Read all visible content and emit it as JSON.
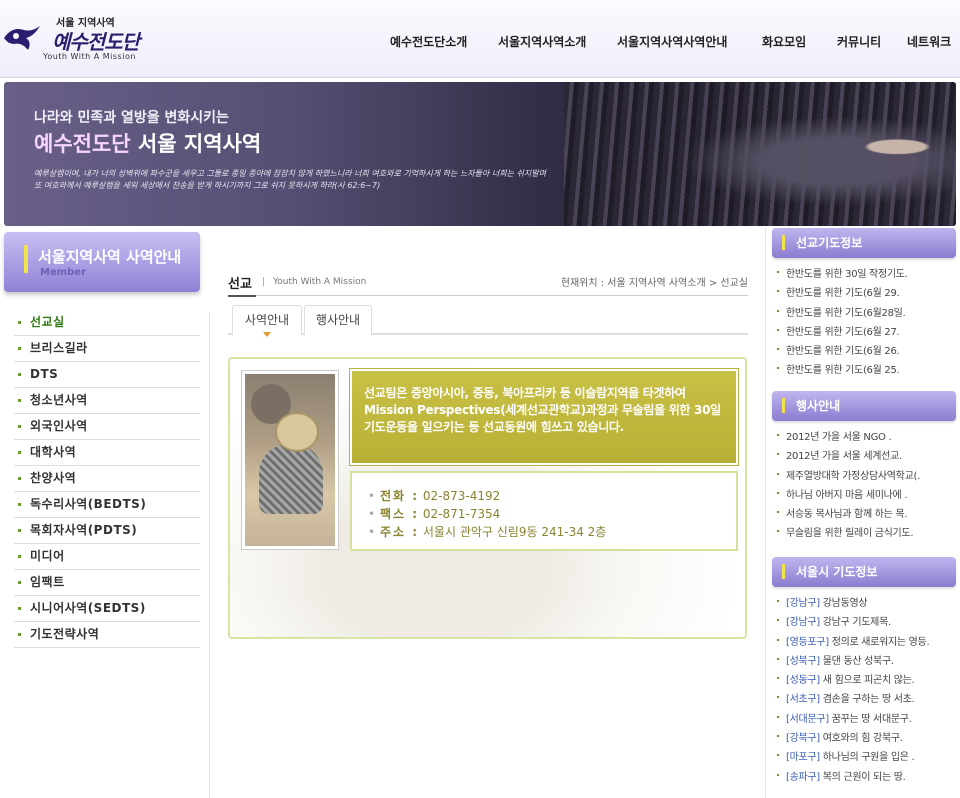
{
  "header": {
    "logo_top": "서울 지역사역",
    "logo_main": "예수전도단",
    "logo_sub": "Youth With A Mission",
    "nav": [
      "예수전도단소개",
      "서울지역사역소개",
      "서울지역사역사역안내",
      "화요모임",
      "커뮤니티",
      "네트워크"
    ]
  },
  "banner": {
    "line1": "나라와 민족과 열방을 변화시키는",
    "line2_a": "예수전도단",
    "line2_b": " 서울 지역사역",
    "desc": "예루살렘이여, 내가 너의 성벽위에 파수군을 세우고 그들로 종일 종야에 잠잠치 않게 하였느니라 너희 여호와로 기억하시게 하는 느자들아 너희는 쉬지말며 또 여호와께서 예루살렘을 세워 세상에서 찬송을 받게 하시기까지 그로 쉬지 못하시게 하라(사 62:6~7)"
  },
  "sidebar": {
    "title": "서울지역사역 사역안내",
    "subtitle": "Member",
    "items": [
      "선교실",
      "브리스길라",
      "DTS",
      "청소년사역",
      "외국인사역",
      "대학사역",
      "찬양사역",
      "독수리사역(BEDTS)",
      "목회자사역(PDTS)",
      "미디어",
      "임팩트",
      "시니어사역(SEDTS)",
      "기도전략사역"
    ]
  },
  "content": {
    "section": "선교",
    "sep": "|",
    "sub": "Youth With A Mission",
    "location": "현재위치 : 서울 지역사역 사역소개 > 선교실",
    "tabs": [
      "사역안내",
      "행사안내"
    ],
    "intro": "선교팀은 중앙아시아, 중동, 북아프리카 등 이슬람지역을 타겟하여 Mission Perspectives(세계선교관학교)과정과 무슬림을 위한 30일 기도운동을 일으키는 등 선교동원에 힘쓰고 있습니다.",
    "phone_label": "전화 :",
    "phone": "02-873-4192",
    "fax_label": "팩스 :",
    "fax": "02-871-7354",
    "addr_label": "주소 :",
    "addr": "서울시 관악구 신림9동 241-34 2층"
  },
  "right": {
    "prayer_title": "선교기도정보",
    "prayer_items": [
      "한반도를 위한 30일 작정기도.",
      "한반도를 위한 기도(6월 29.",
      "한반도를 위한 기도(6월28일.",
      "한반도를 위한 기도(6월 27.",
      "한반도를 위한 기도(6월 26.",
      "한반도를 위한 기도(6월 25."
    ],
    "event_title": "행사안내",
    "event_items": [
      "2012년 가을 서울 NGO .",
      "2012년 가을 서울 세계선교.",
      "제주열방대학 가정상담사역학교(.",
      "하나님 아버지 마음 세미나에 .",
      "서승동 목사님과 함께 하는 목.",
      "무슬림을 위한 릴레이 금식기도."
    ],
    "seoul_title": "서울시 기도정보",
    "seoul_items": [
      {
        "tag": "[강남구]",
        "text": " 강남동영상"
      },
      {
        "tag": "[강남구]",
        "text": " 강남구 기도제목."
      },
      {
        "tag": "[영등포구]",
        "text": " 정의로 새로워지는 영등."
      },
      {
        "tag": "[성북구]",
        "text": " 물댄 동산 성북구."
      },
      {
        "tag": "[성동구]",
        "text": " 새 힘으로 피곤치 않는."
      },
      {
        "tag": "[서초구]",
        "text": " 겸손을 구하는 땅 서초."
      },
      {
        "tag": "[서대문구]",
        "text": " 꿈꾸는 땅 서대문구."
      },
      {
        "tag": "[강북구]",
        "text": " 여호와의 힘 강북구."
      },
      {
        "tag": "[마포구]",
        "text": " 하나님의 구원을 입은 ."
      },
      {
        "tag": "[송파구]",
        "text": " 복의 근원이 되는 땅."
      }
    ]
  }
}
